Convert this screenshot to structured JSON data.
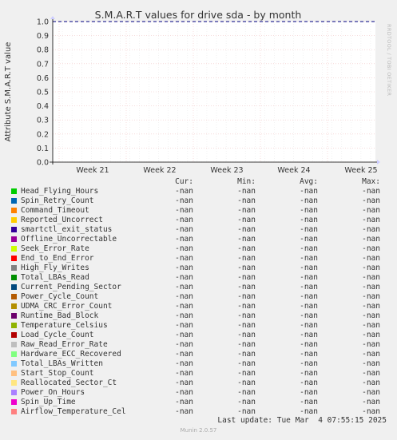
{
  "chart_data": {
    "type": "line",
    "title": "S.M.A.R.T values for drive sda - by month",
    "ylabel": "Attribute S.M.A.R.T value",
    "xlabel": "",
    "ylim": [
      0,
      1.0
    ],
    "yticks": [
      "0.0",
      "0.1",
      "0.2",
      "0.3",
      "0.4",
      "0.5",
      "0.6",
      "0.7",
      "0.8",
      "0.9",
      "1.0"
    ],
    "xticks": [
      "Week 21",
      "Week 22",
      "Week 23",
      "Week 24",
      "Week 25"
    ],
    "threshold_line": {
      "y": 1.0,
      "color": "#000080"
    },
    "grid": true,
    "legend_placement": "bottom",
    "columns": [
      "Cur:",
      "Min:",
      "Avg:",
      "Max:"
    ],
    "series": [
      {
        "name": "Head_Flying_Hours",
        "color": "#00cc00",
        "cur": "-nan",
        "min": "-nan",
        "avg": "-nan",
        "max": "-nan"
      },
      {
        "name": "Spin_Retry_Count",
        "color": "#0066b3",
        "cur": "-nan",
        "min": "-nan",
        "avg": "-nan",
        "max": "-nan"
      },
      {
        "name": "Command_Timeout",
        "color": "#ff8000",
        "cur": "-nan",
        "min": "-nan",
        "avg": "-nan",
        "max": "-nan"
      },
      {
        "name": "Reported_Uncorrect",
        "color": "#ffcc00",
        "cur": "-nan",
        "min": "-nan",
        "avg": "-nan",
        "max": "-nan"
      },
      {
        "name": "smartctl_exit_status",
        "color": "#330099",
        "cur": "-nan",
        "min": "-nan",
        "avg": "-nan",
        "max": "-nan"
      },
      {
        "name": "Offline_Uncorrectable",
        "color": "#990099",
        "cur": "-nan",
        "min": "-nan",
        "avg": "-nan",
        "max": "-nan"
      },
      {
        "name": "Seek_Error_Rate",
        "color": "#ccff00",
        "cur": "-nan",
        "min": "-nan",
        "avg": "-nan",
        "max": "-nan"
      },
      {
        "name": "End_to_End_Error",
        "color": "#ff0000",
        "cur": "-nan",
        "min": "-nan",
        "avg": "-nan",
        "max": "-nan"
      },
      {
        "name": "High_Fly_Writes",
        "color": "#808080",
        "cur": "-nan",
        "min": "-nan",
        "avg": "-nan",
        "max": "-nan"
      },
      {
        "name": "Total_LBAs_Read",
        "color": "#008f00",
        "cur": "-nan",
        "min": "-nan",
        "avg": "-nan",
        "max": "-nan"
      },
      {
        "name": "Current_Pending_Sector",
        "color": "#00487d",
        "cur": "-nan",
        "min": "-nan",
        "avg": "-nan",
        "max": "-nan"
      },
      {
        "name": "Power_Cycle_Count",
        "color": "#b35a00",
        "cur": "-nan",
        "min": "-nan",
        "avg": "-nan",
        "max": "-nan"
      },
      {
        "name": "UDMA_CRC_Error_Count",
        "color": "#b38f00",
        "cur": "-nan",
        "min": "-nan",
        "avg": "-nan",
        "max": "-nan"
      },
      {
        "name": "Runtime_Bad_Block",
        "color": "#6b006b",
        "cur": "-nan",
        "min": "-nan",
        "avg": "-nan",
        "max": "-nan"
      },
      {
        "name": "Temperature_Celsius",
        "color": "#8fb300",
        "cur": "-nan",
        "min": "-nan",
        "avg": "-nan",
        "max": "-nan"
      },
      {
        "name": "Load_Cycle_Count",
        "color": "#b30000",
        "cur": "-nan",
        "min": "-nan",
        "avg": "-nan",
        "max": "-nan"
      },
      {
        "name": "Raw_Read_Error_Rate",
        "color": "#bebebe",
        "cur": "-nan",
        "min": "-nan",
        "avg": "-nan",
        "max": "-nan"
      },
      {
        "name": "Hardware_ECC_Recovered",
        "color": "#80ff80",
        "cur": "-nan",
        "min": "-nan",
        "avg": "-nan",
        "max": "-nan"
      },
      {
        "name": "Total_LBAs_Written",
        "color": "#80c9ff",
        "cur": "-nan",
        "min": "-nan",
        "avg": "-nan",
        "max": "-nan"
      },
      {
        "name": "Start_Stop_Count",
        "color": "#ffc080",
        "cur": "-nan",
        "min": "-nan",
        "avg": "-nan",
        "max": "-nan"
      },
      {
        "name": "Reallocated_Sector_Ct",
        "color": "#ffe680",
        "cur": "-nan",
        "min": "-nan",
        "avg": "-nan",
        "max": "-nan"
      },
      {
        "name": "Power_On_Hours",
        "color": "#aa80ff",
        "cur": "-nan",
        "min": "-nan",
        "avg": "-nan",
        "max": "-nan"
      },
      {
        "name": "Spin_Up_Time",
        "color": "#ee00cc",
        "cur": "-nan",
        "min": "-nan",
        "avg": "-nan",
        "max": "-nan"
      },
      {
        "name": "Airflow_Temperature_Cel",
        "color": "#ff8080",
        "cur": "-nan",
        "min": "-nan",
        "avg": "-nan",
        "max": "-nan"
      }
    ]
  },
  "last_update": "Last update: Tue Mar  4 07:55:15 2025",
  "footer": "Munin 2.0.57",
  "watermark": "RRDTOOL / TOBI OETIKER"
}
